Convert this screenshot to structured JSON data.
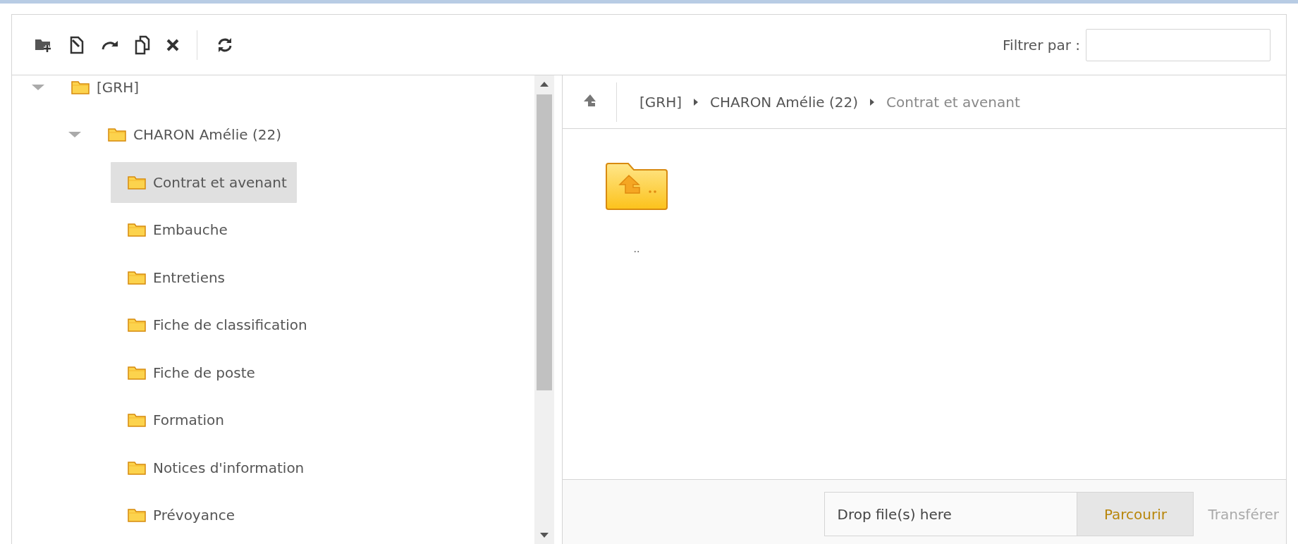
{
  "toolbar": {
    "buttons": [
      {
        "kind": "new-folder"
      },
      {
        "kind": "rename"
      },
      {
        "kind": "move"
      },
      {
        "kind": "copy"
      },
      {
        "kind": "delete"
      },
      {
        "kind": "refresh"
      }
    ],
    "filter_label": "Filtrer par :"
  },
  "tree": [
    {
      "label": "[GRH]",
      "expanded": true,
      "selected": false,
      "children": [
        {
          "label": "CHARON Amélie (22)",
          "expanded": true,
          "selected": false,
          "children": [
            {
              "label": "Contrat et avenant",
              "selected": true
            },
            {
              "label": "Embauche",
              "selected": false
            },
            {
              "label": "Entretiens",
              "selected": false
            },
            {
              "label": "Fiche de classification",
              "selected": false
            },
            {
              "label": "Fiche de poste",
              "selected": false
            },
            {
              "label": "Formation",
              "selected": false
            },
            {
              "label": "Notices d'information",
              "selected": false
            },
            {
              "label": "Prévoyance",
              "selected": false
            }
          ]
        }
      ]
    }
  ],
  "breadcrumb": [
    {
      "label": "[GRH]",
      "current": false
    },
    {
      "label": "CHARON Amélie (22)",
      "current": false
    },
    {
      "label": "Contrat et avenant",
      "current": true
    }
  ],
  "files": [
    {
      "label": "..",
      "kind": "parent-folder"
    }
  ],
  "upload": {
    "dropzone": "Drop file(s) here",
    "browse": "Parcourir",
    "transfer": {
      "label": "Transférer",
      "disabled": true
    }
  }
}
